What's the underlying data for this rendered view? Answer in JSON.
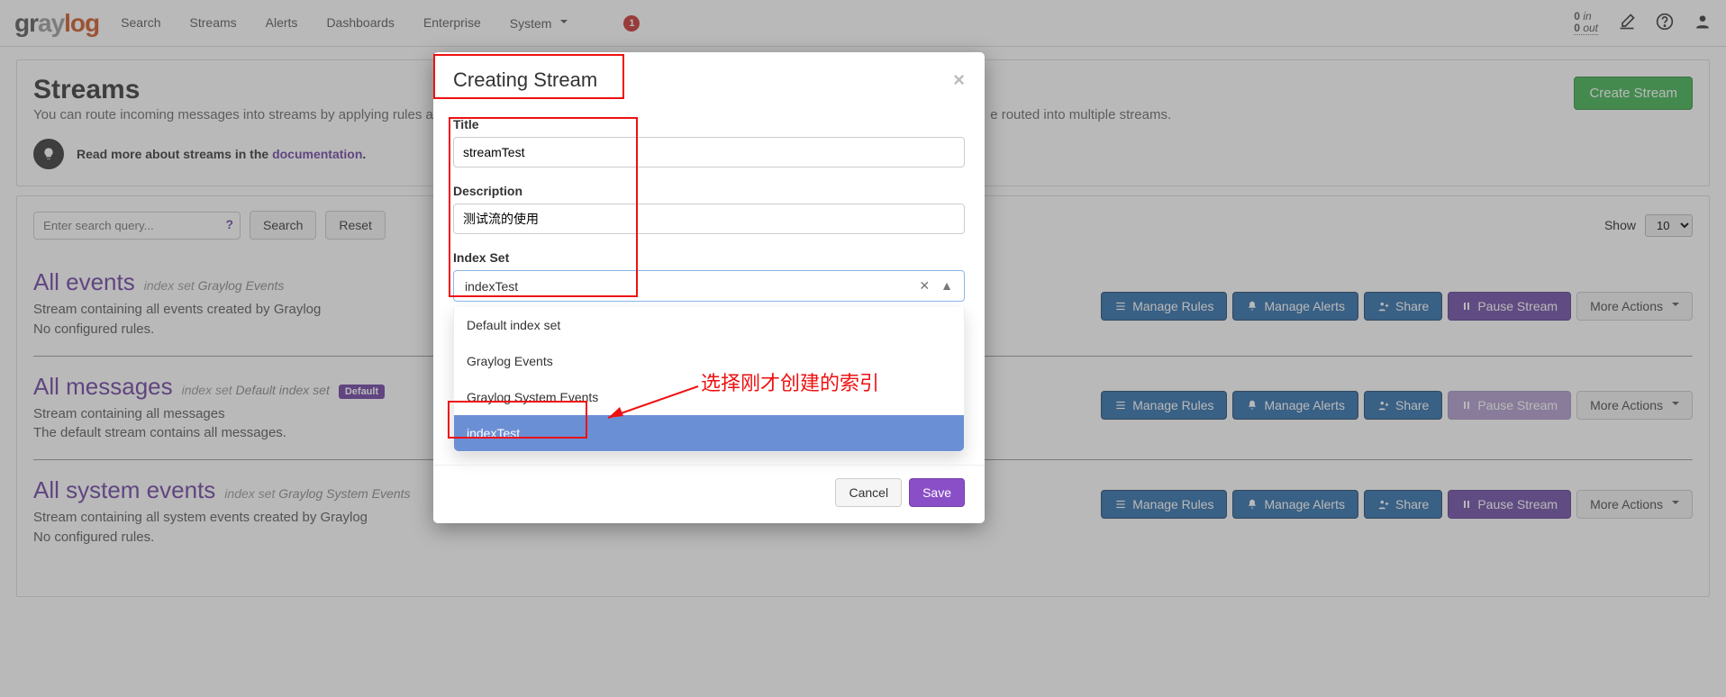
{
  "brand_parts": {
    "g1": "gr",
    "g2": "ay",
    "g3": "log"
  },
  "nav": [
    "Search",
    "Streams",
    "Alerts",
    "Dashboards",
    "Enterprise",
    "System"
  ],
  "nav_badge": "1",
  "throughput": {
    "in_n": "0",
    "in_l": "in",
    "out_n": "0",
    "out_l": "out"
  },
  "page": {
    "title": "Streams",
    "subtitle_visible": "You can route incoming messages into streams by applying rules a",
    "subtitle_right": "e routed into multiple streams.",
    "readmore_text": "Read more about streams in the ",
    "readmore_link": "documentation",
    "create_btn": "Create Stream"
  },
  "search": {
    "placeholder": "Enter search query...",
    "search_btn": "Search",
    "reset_btn": "Reset",
    "show_label": "Show",
    "show_value": "10"
  },
  "streams": [
    {
      "name": "All events",
      "idx_prefix": "index set",
      "idx_name": "Graylog Events",
      "default": false,
      "desc1": "Stream containing all events created by Graylog",
      "desc2": "No configured rules.",
      "pause_disabled": false
    },
    {
      "name": "All messages",
      "idx_prefix": "index set",
      "idx_name": "Default index set",
      "default": true,
      "desc1": "Stream containing all messages",
      "desc2": "The default stream contains all messages.",
      "pause_disabled": true
    },
    {
      "name": "All system events",
      "idx_prefix": "index set",
      "idx_name": "Graylog System Events",
      "default": false,
      "desc1": "Stream containing all system events created by Graylog",
      "desc2": "No configured rules.",
      "pause_disabled": false
    }
  ],
  "actions": {
    "manage_rules": "Manage Rules",
    "manage_alerts": "Manage Alerts",
    "share": "Share",
    "pause": "Pause Stream",
    "more": "More Actions"
  },
  "badge_default": "Default",
  "modal": {
    "title": "Creating Stream",
    "title_label": "Title",
    "title_value": "streamTest",
    "desc_label": "Description",
    "desc_value": "测试流的使用",
    "idx_label": "Index Set",
    "idx_value": "indexTest",
    "options": [
      "Default index set",
      "Graylog Events",
      "Graylog System Events",
      "indexTest"
    ],
    "cancel": "Cancel",
    "save": "Save"
  },
  "annotation_text": "选择刚才创建的索引"
}
